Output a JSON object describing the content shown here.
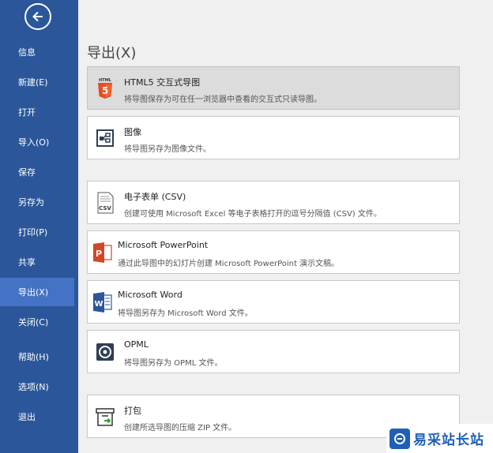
{
  "sidebar": {
    "items": [
      {
        "label": "信息"
      },
      {
        "label": "新建(E)"
      },
      {
        "label": "打开"
      },
      {
        "label": "导入(O)"
      },
      {
        "label": "保存"
      },
      {
        "label": "另存为"
      },
      {
        "label": "打印(P)"
      },
      {
        "label": "共享"
      },
      {
        "label": "导出(X)",
        "active": true
      },
      {
        "label": "关闭(C)"
      },
      {
        "label": "帮助(H)"
      },
      {
        "label": "选项(N)"
      },
      {
        "label": "退出"
      }
    ]
  },
  "main": {
    "title": "导出(X)",
    "options": [
      {
        "title": "HTML5 交互式导图",
        "desc": "将导图保存为可在任一浏览器中查看的交互式只读导图。",
        "icon": "html5-icon",
        "selected": true
      },
      {
        "title": "图像",
        "desc": "将导图另存为图像文件。",
        "icon": "image-icon"
      },
      {
        "title": "电子表单 (CSV)",
        "desc": "创建可使用 Microsoft Excel 等电子表格打开的逗号分隔值 (CSV) 文件。",
        "icon": "csv-icon"
      },
      {
        "title": "Microsoft PowerPoint",
        "desc": "通过此导图中的幻灯片创建 Microsoft PowerPoint 演示文稿。",
        "icon": "powerpoint-icon"
      },
      {
        "title": "Microsoft Word",
        "desc": "将导图另存为 Microsoft Word 文件。",
        "icon": "word-icon"
      },
      {
        "title": "OPML",
        "desc": "将导图另存为 OPML 文件。",
        "icon": "opml-icon"
      },
      {
        "title": "打包",
        "desc": "创建所选导图的压缩 ZIP 文件。",
        "icon": "package-icon"
      }
    ]
  },
  "watermark": {
    "text": "易采站长站"
  },
  "colors": {
    "sidebar": "#2b579a",
    "sidebar_active": "#4472c4",
    "html5": "#e44d26",
    "powerpoint": "#d24726",
    "word": "#2b579a"
  }
}
